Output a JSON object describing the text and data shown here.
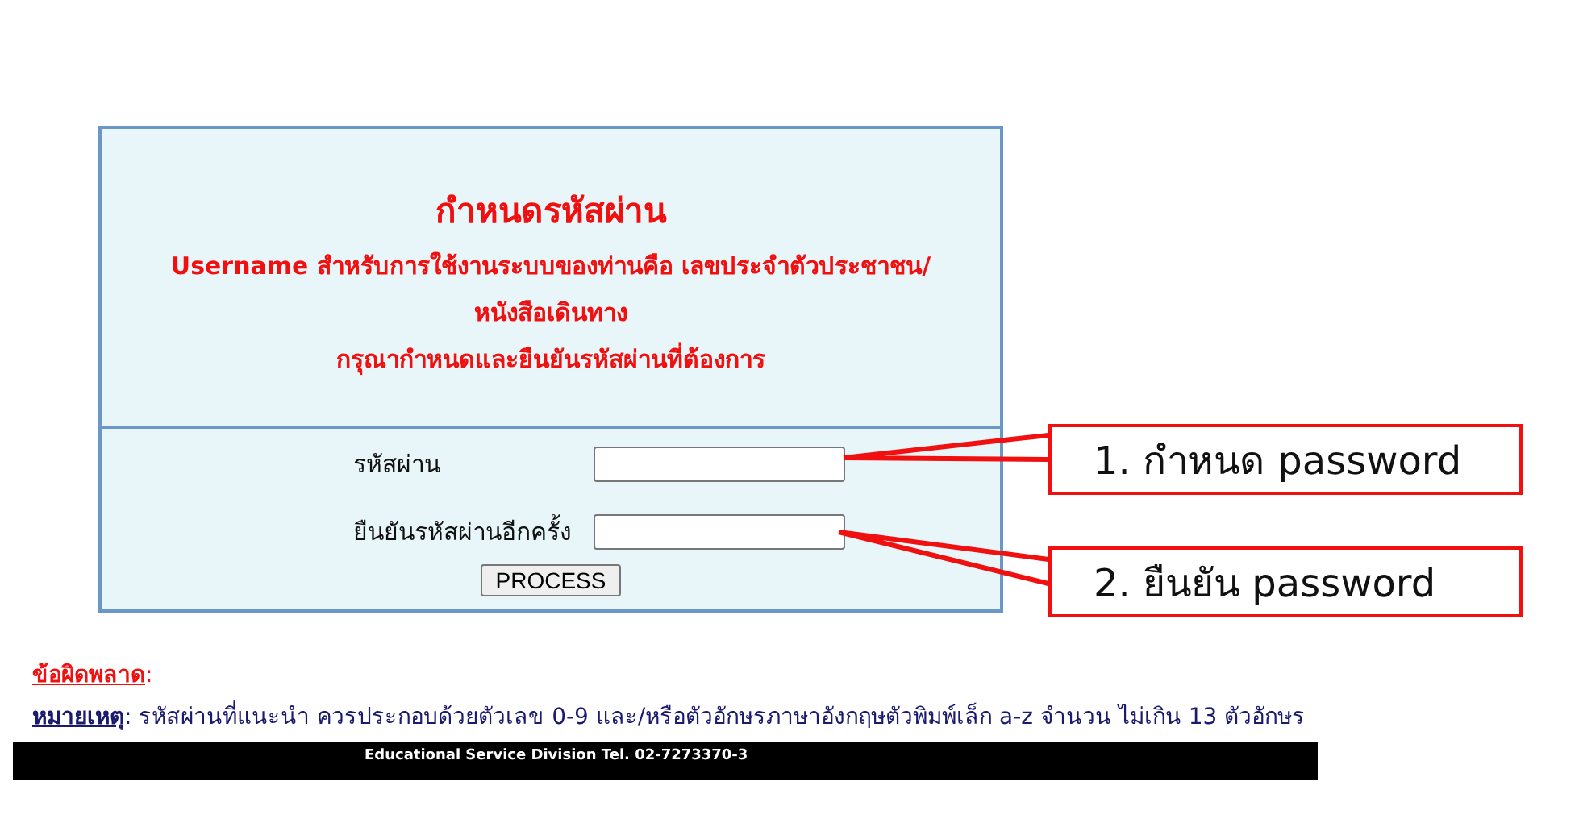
{
  "panel": {
    "title": "กำหนดรหัสผ่าน",
    "message_lines": [
      "Username สำหรับการใช้งานระบบของท่านคือ เลขประจำตัวประชาชน/",
      "หนังสือเดินทาง",
      "กรุณากำหนดและยืนยันรหัสผ่านที่ต้องการ"
    ],
    "fields": [
      {
        "label": "รหัสผ่าน"
      },
      {
        "label": "ยืนยันรหัสผ่านอีกครั้ง"
      }
    ],
    "button": "PROCESS"
  },
  "callouts": [
    {
      "text": "1. กำหนด password"
    },
    {
      "text": "2. ยืนยัน password"
    }
  ],
  "error": {
    "label": "ข้อผิดพลาด",
    "suffix": ":"
  },
  "note": {
    "label": "หมายเหตุ",
    "text": ": รหัสผ่านที่แนะนำ ควรประกอบด้วยตัวเลข 0-9 และ/หรือตัวอักษรภาษาอังกฤษตัวพิมพ์เล็ก a-z จำนวน ไม่เกิน 13 ตัวอักษร"
  },
  "footer": "Educational Service Division Tel. 02-7273370-3"
}
